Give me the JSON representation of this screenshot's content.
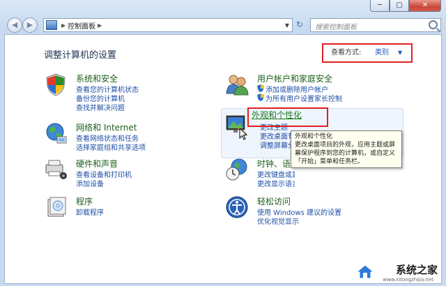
{
  "window": {
    "controls": {
      "minimize": "─",
      "maximize": "▢",
      "close": "✕"
    }
  },
  "navbar": {
    "back": "◀",
    "forward": "▶",
    "breadcrumb": [
      "控制面板"
    ],
    "refresh": "↻",
    "search_placeholder": "搜索控制面板"
  },
  "content": {
    "heading": "调整计算机的设置",
    "view_by": {
      "label": "查看方式:",
      "value": "类别",
      "caret": "▼"
    },
    "left": [
      {
        "title": "系统和安全",
        "icon": "system-security-icon",
        "links": [
          "查看您的计算机状态",
          "备份您的计算机",
          "查找并解决问题"
        ]
      },
      {
        "title": "网络和 Internet",
        "icon": "network-icon",
        "links": [
          "查看网络状态和任务",
          "选择家庭组和共享选项"
        ]
      },
      {
        "title": "硬件和声音",
        "icon": "hardware-sound-icon",
        "links": [
          "查看设备和打印机",
          "添加设备"
        ]
      },
      {
        "title": "程序",
        "icon": "programs-icon",
        "links": [
          "卸载程序"
        ]
      }
    ],
    "right": [
      {
        "title": "用户帐户和家庭安全",
        "icon": "users-icon",
        "links": [
          "添加或删除用户帐户",
          "为所有用户设置家长控制"
        ]
      },
      {
        "title": "外观和个性化",
        "icon": "appearance-icon",
        "links": [
          "更改主题",
          "更改桌面背景",
          "调整屏幕分辨率"
        ]
      },
      {
        "title": "时钟、语言和区域",
        "icon": "clock-globe-icon",
        "links": [
          "更改键盘或其他输入法",
          "更改显示语言"
        ]
      },
      {
        "title": "轻松访问",
        "icon": "ease-access-icon",
        "links": [
          "使用 Windows 建议的设置",
          "优化视觉显示"
        ]
      }
    ]
  },
  "tooltip": {
    "lines": [
      "外观和个性化",
      "更改桌面项目的外观，应用主题或屏",
      "幕保护程序到您的计算机，或自定义",
      "「开始」菜单和任务栏。"
    ]
  },
  "watermark": {
    "text": "系统之家",
    "url": "www.xitongzhijia.net"
  }
}
